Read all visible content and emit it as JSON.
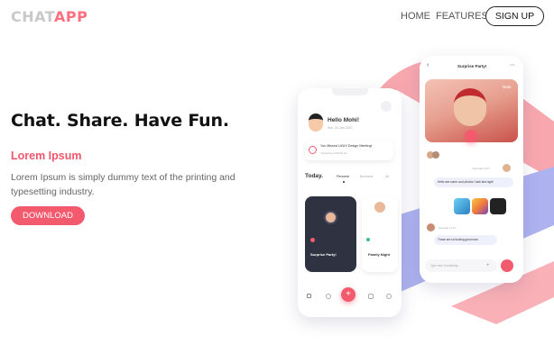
{
  "nav": {
    "logo_part1": "CHAT",
    "logo_part2": "APP",
    "home": "HOME",
    "features": "FEATURES",
    "signup": "SIGN UP"
  },
  "hero": {
    "headline": "Chat. Share. Have Fun.",
    "subheading": "Lorem Ipsum",
    "description": "Lorem Ipsum is simply dummy text of the printing and typesetting industry.",
    "download": "DOWNLOAD"
  },
  "phone_left": {
    "greeting": "Hello Mohi!",
    "date": "Sun, 24 Jan 2022",
    "notification": "You Missed UI/UX Design Meeting!",
    "notification_time": "Yesterday at 08:00 am",
    "section_title": "Today.",
    "tabs": [
      "Personal",
      "Business",
      "All"
    ],
    "card_dark_title": "Surprise Party!",
    "card_light_title": "Family Night"
  },
  "phone_right": {
    "title": "Surprise Party!",
    "caller": "Mala",
    "messages": [
      {
        "text": "Hello see some cool photos I took last night"
      },
      {
        "text": "Those are so fucking good man"
      }
    ],
    "input_placeholder": "Type here Something...",
    "time_label_1": "Yesterday 11:07",
    "time_label_2": "Yesterday 11:10"
  },
  "colors": {
    "accent": "#f35a6e",
    "ribbon_pink": "#f8a7ae",
    "ribbon_blue": "#aeb3f0"
  }
}
